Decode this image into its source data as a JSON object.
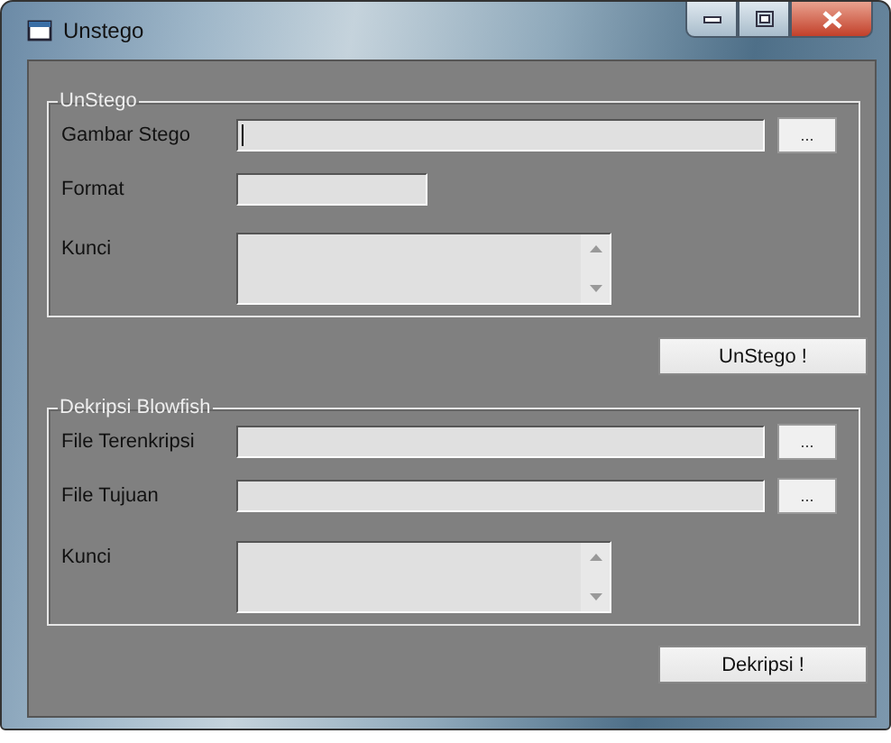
{
  "window": {
    "title": "Unstego"
  },
  "groups": [
    {
      "title": "UnStego",
      "rows": [
        {
          "label": "Gambar Stego",
          "kind": "file",
          "browse": "...",
          "focused": true
        },
        {
          "label": "Format",
          "kind": "short",
          "focused": false
        },
        {
          "label": "Kunci",
          "kind": "memo",
          "focused": false
        }
      ],
      "action": "UnStego !"
    },
    {
      "title": "Dekripsi Blowfish",
      "rows": [
        {
          "label": "File Terenkripsi",
          "kind": "file",
          "browse": "...",
          "focused": false
        },
        {
          "label": "File Tujuan",
          "kind": "file",
          "browse": "...",
          "focused": false
        },
        {
          "label": "Kunci",
          "kind": "memo",
          "focused": false
        }
      ],
      "action": "Dekripsi !"
    }
  ]
}
